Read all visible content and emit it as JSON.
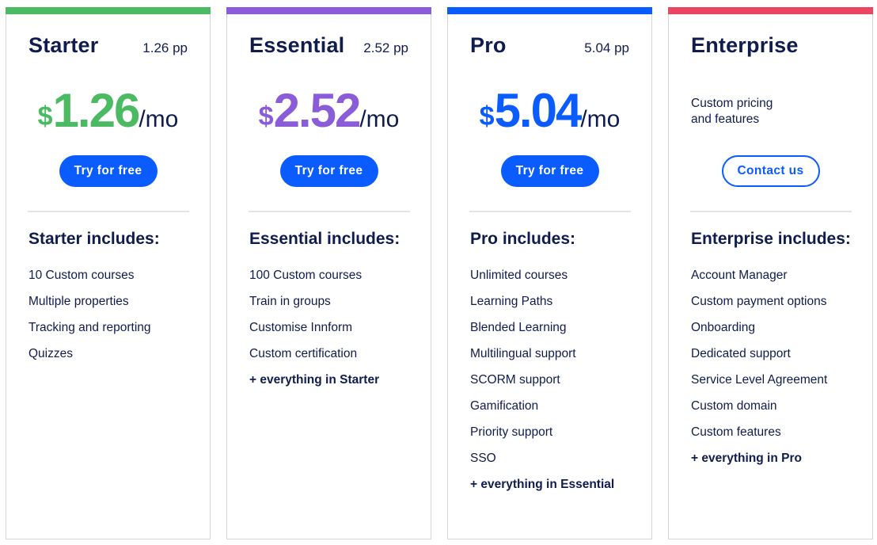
{
  "colors": {
    "starter": "#4cb963",
    "essential": "#8a5cd8",
    "pro": "#0a5cff",
    "enterprise": "#ea4662",
    "text": "#0f1c4d",
    "button": "#0a5cff"
  },
  "plans": [
    {
      "name": "Starter",
      "per_person": "1.26 pp",
      "currency": "$",
      "amount": "1.26",
      "period": "/mo",
      "button_label": "Try for free",
      "includes_heading": "Starter includes:",
      "features": [
        "10 Custom courses",
        "Multiple properties",
        "Tracking and reporting",
        "Quizzes"
      ],
      "extra": ""
    },
    {
      "name": "Essential",
      "per_person": "2.52 pp",
      "currency": "$",
      "amount": "2.52",
      "period": "/mo",
      "button_label": "Try for free",
      "includes_heading": "Essential includes:",
      "features": [
        "100 Custom courses",
        "Train in groups",
        "Customise Innform",
        "Custom certification"
      ],
      "extra": "+ everything in Starter"
    },
    {
      "name": "Pro",
      "per_person": "5.04 pp",
      "currency": "$",
      "amount": "5.04",
      "period": "/mo",
      "button_label": "Try for free",
      "includes_heading": "Pro includes:",
      "features": [
        "Unlimited courses",
        "Learning Paths",
        "Blended Learning",
        "Multilingual support",
        "SCORM support",
        "Gamification",
        "Priority support",
        "SSO"
      ],
      "extra": "+ everything in Essential"
    },
    {
      "name": "Enterprise",
      "description_line1": "Custom pricing",
      "description_line2": "and features",
      "button_label": "Contact us",
      "includes_heading": "Enterprise includes:",
      "features": [
        "Account Manager",
        "Custom payment options",
        "Onboarding",
        "Dedicated support",
        "Service Level Agreement",
        "Custom domain",
        "Custom features"
      ],
      "extra": "+ everything in Pro"
    }
  ]
}
